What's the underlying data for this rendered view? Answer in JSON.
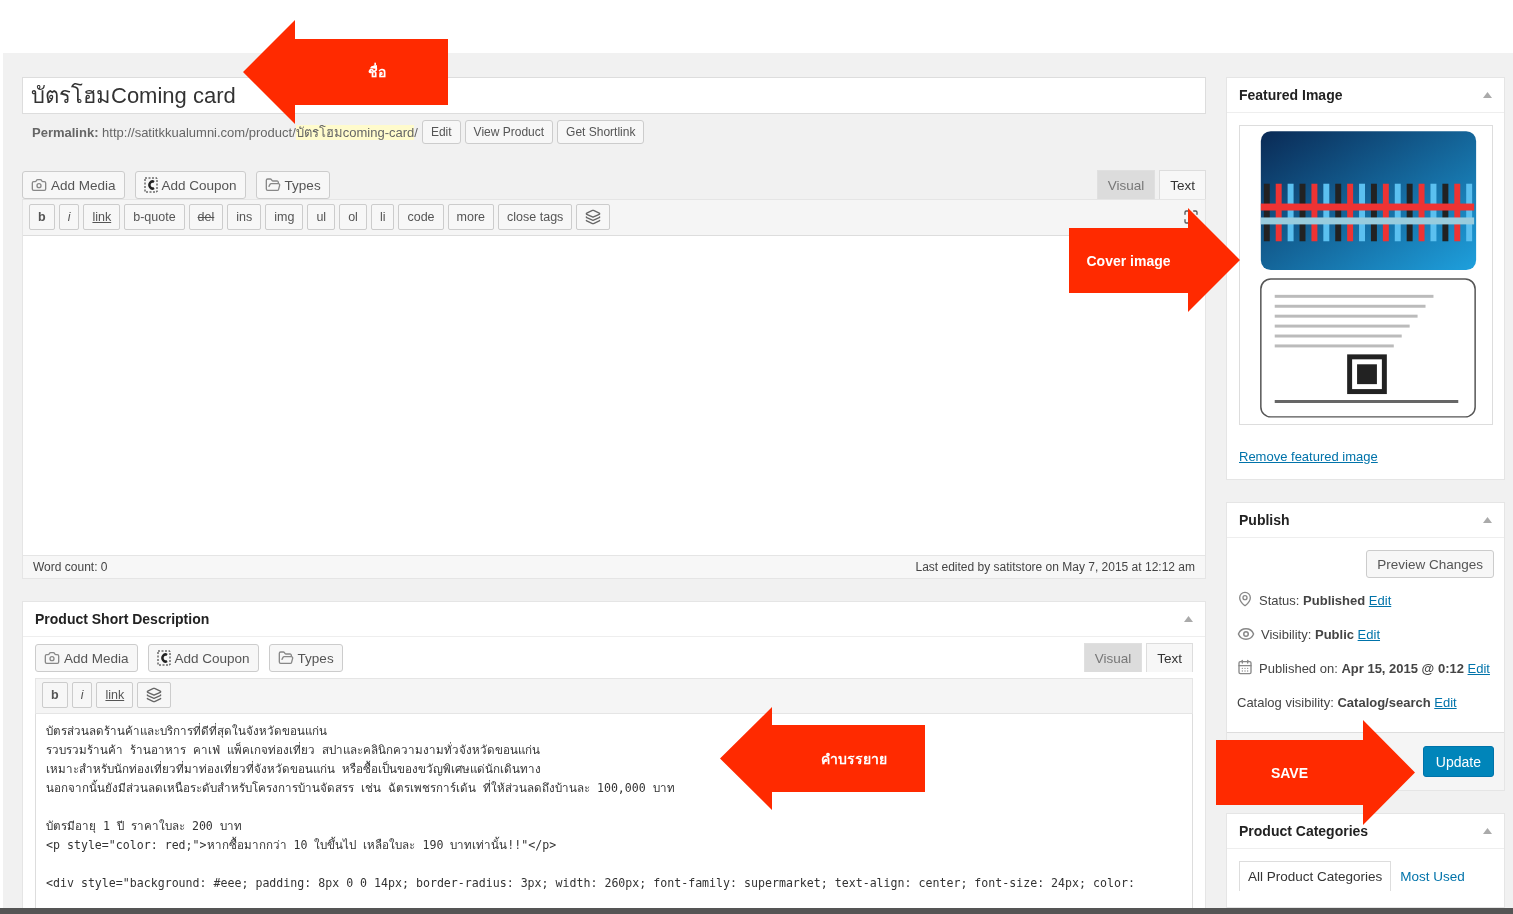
{
  "title": "บัตรโฮมComing card",
  "permalink": {
    "label": "Permalink:",
    "base": "http://satitkkualumni.com/product/",
    "slug": "บัตรโฮมcoming-card",
    "trail": "/",
    "buttons": [
      "Edit",
      "View Product",
      "Get Shortlink"
    ]
  },
  "editor": {
    "media_buttons": [
      {
        "label": "Add Media",
        "kind": "media"
      },
      {
        "label": "Add Coupon",
        "kind": "coupon"
      },
      {
        "label": "Types",
        "kind": "types"
      }
    ],
    "tabs": [
      {
        "label": "Visual",
        "selected": false
      },
      {
        "label": "Text",
        "selected": true
      }
    ],
    "quicktags": [
      {
        "label": "b",
        "kind": "bold"
      },
      {
        "label": "i",
        "kind": "italic"
      },
      {
        "label": "link",
        "kind": "link"
      },
      {
        "label": "b-quote",
        "kind": "plain"
      },
      {
        "label": "del",
        "kind": "del"
      },
      {
        "label": "ins",
        "kind": "plain"
      },
      {
        "label": "img",
        "kind": "plain"
      },
      {
        "label": "ul",
        "kind": "plain"
      },
      {
        "label": "ol",
        "kind": "plain"
      },
      {
        "label": "li",
        "kind": "plain"
      },
      {
        "label": "code",
        "kind": "plain"
      },
      {
        "label": "more",
        "kind": "plain"
      },
      {
        "label": "close tags",
        "kind": "plain"
      },
      {
        "kind": "icon"
      }
    ],
    "word_count": "Word count: 0",
    "last_edited": "Last edited by satitstore on May 7, 2015 at 12:12 am"
  },
  "short_description": {
    "title": "Product Short Description",
    "media_buttons": [
      {
        "label": "Add Media",
        "kind": "media"
      },
      {
        "label": "Add Coupon",
        "kind": "coupon"
      },
      {
        "label": "Types",
        "kind": "types"
      }
    ],
    "tabs": [
      {
        "label": "Visual",
        "selected": false
      },
      {
        "label": "Text",
        "selected": true
      }
    ],
    "quicktags": [
      {
        "label": "b",
        "kind": "bold"
      },
      {
        "label": "i",
        "kind": "italic"
      },
      {
        "label": "link",
        "kind": "link"
      },
      {
        "kind": "icon"
      }
    ],
    "paragraphs": [
      [
        "บัตรส่วนลดร้านค้าและบริการที่ดีที่สุดในจังหวัดขอนแก่น",
        "รวบรวมร้านค้า ร้านอาหาร คาเฟ่ แพ็คเกจท่องเที่ยว สปาและคลินิกความงามทั่วจังหวัดขอนแก่น",
        "เหมาะสำหรับนักท่องเที่ยวที่มาท่องเที่ยวที่จังหวัดขอนแก่น หรือซื้อเป็นของขวัญพิเศษแด่นักเดินทาง",
        "นอกจากนั้นยังมีส่วนลดเหนือระดับสำหรับโครงการบ้านจัดสรร เช่น ฉัตรเพชรการ์เด้น ที่ให้ส่วนลดถึงบ้านละ 100,000 บาท"
      ],
      [
        "บัตรมีอายุ 1 ปี ราคาใบละ 200 บาท",
        "<p style=\"color: red;\">หากซื้อมากกว่า 10 ใบขึ้นไป เหลือใบละ 190 บาทเท่านั้น!!\"</p>"
      ],
      [
        "<div style=\"background: #eee; padding: 8px 0 0 14px; border-radius: 3px; width: 260px; font-family: supermarket; text-align: center; font-size: 24px; color:"
      ]
    ]
  },
  "sidebar": {
    "featured_image": {
      "title": "Featured Image",
      "remove_link": "Remove featured image"
    },
    "publish": {
      "title": "Publish",
      "preview_button": "Preview Changes",
      "items": [
        {
          "kind": "status",
          "label": "Status:",
          "value": "Published",
          "link": "Edit"
        },
        {
          "kind": "visibility",
          "label": "Visibility:",
          "value": "Public",
          "link": "Edit"
        },
        {
          "kind": "date",
          "label": "Published on:",
          "value": "Apr 15, 2015 @ 0:12",
          "link": "Edit"
        },
        {
          "kind": "catalog",
          "label": "Catalog visibility:",
          "value": "Catalog/search",
          "link": "Edit"
        }
      ],
      "update_button": "Update"
    },
    "categories": {
      "title": "Product Categories",
      "tabs": [
        {
          "label": "All Product Categories",
          "selected": true
        },
        {
          "label": "Most Used",
          "selected": false
        }
      ]
    }
  },
  "annotations": [
    {
      "text": "ชื่อ"
    },
    {
      "text": "Cover image"
    },
    {
      "text": "คำบรรยาย"
    },
    {
      "text": "SAVE"
    }
  ]
}
